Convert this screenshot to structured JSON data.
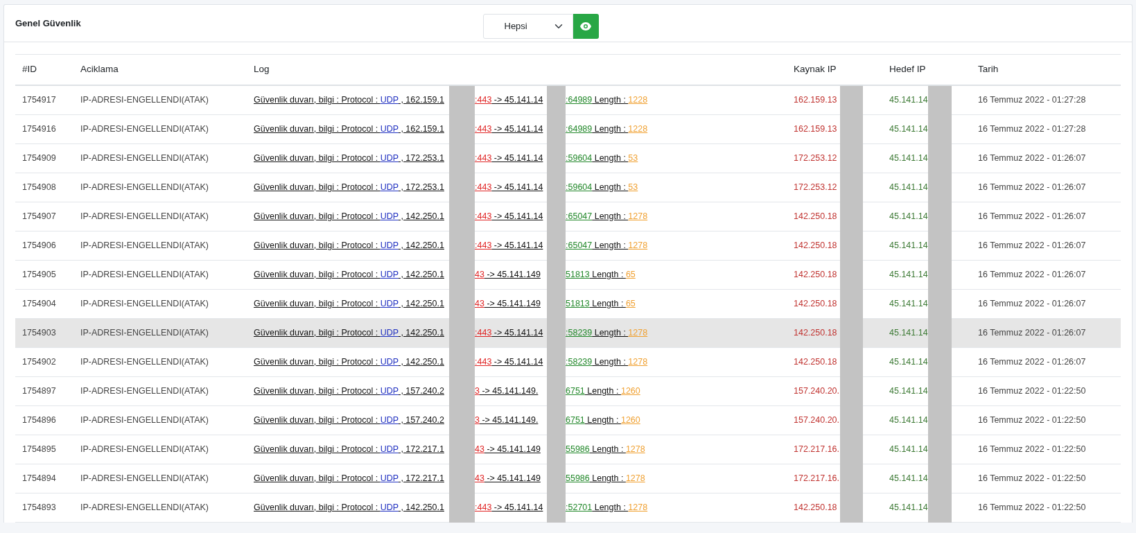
{
  "card": {
    "title": "Genel Güvenlik",
    "filter": {
      "value": "Hepsi"
    }
  },
  "table": {
    "columns": [
      "#ID",
      "Aciklama",
      "Log",
      "Kaynak IP",
      "Hedef IP",
      "Tarih"
    ],
    "rows": [
      {
        "id": "1754917",
        "description": "IP-ADRESI-ENGELLENDI(ATAK)",
        "log": {
          "label": "Güvenlik duvarı, bilgi : Protocol :",
          "protocol": "UDP",
          "source": ", 162.159.1",
          "source_port": ":443",
          "destination": "-> 45.141.14",
          "destination_port": ":64989",
          "length_label": "Length :",
          "length": "1228"
        },
        "source_ip": "162.159.13",
        "target_ip": "45.141.14",
        "date": "16 Temmuz 2022 - 01:27:28",
        "hovered": false
      },
      {
        "id": "1754916",
        "description": "IP-ADRESI-ENGELLENDI(ATAK)",
        "log": {
          "label": "Güvenlik duvarı, bilgi : Protocol :",
          "protocol": "UDP",
          "source": ", 162.159.1",
          "source_port": ":443",
          "destination": "-> 45.141.14",
          "destination_port": ":64989",
          "length_label": "Length :",
          "length": "1228"
        },
        "source_ip": "162.159.13",
        "target_ip": "45.141.14",
        "date": "16 Temmuz 2022 - 01:27:28",
        "hovered": false
      },
      {
        "id": "1754909",
        "description": "IP-ADRESI-ENGELLENDI(ATAK)",
        "log": {
          "label": "Güvenlik duvarı, bilgi : Protocol :",
          "protocol": "UDP",
          "source": ", 172.253.1",
          "source_port": ":443",
          "destination": "-> 45.141.14",
          "destination_port": ":59604",
          "length_label": "Length :",
          "length": "53"
        },
        "source_ip": "172.253.12",
        "target_ip": "45.141.14",
        "date": "16 Temmuz 2022 - 01:26:07",
        "hovered": false
      },
      {
        "id": "1754908",
        "description": "IP-ADRESI-ENGELLENDI(ATAK)",
        "log": {
          "label": "Güvenlik duvarı, bilgi : Protocol :",
          "protocol": "UDP",
          "source": ", 172.253.1",
          "source_port": ":443",
          "destination": "-> 45.141.14",
          "destination_port": ":59604",
          "length_label": "Length :",
          "length": "53"
        },
        "source_ip": "172.253.12",
        "target_ip": "45.141.14",
        "date": "16 Temmuz 2022 - 01:26:07",
        "hovered": false
      },
      {
        "id": "1754907",
        "description": "IP-ADRESI-ENGELLENDI(ATAK)",
        "log": {
          "label": "Güvenlik duvarı, bilgi : Protocol :",
          "protocol": "UDP",
          "source": ", 142.250.1",
          "source_port": ":443",
          "destination": "-> 45.141.14",
          "destination_port": ":65047",
          "length_label": "Length :",
          "length": "1278"
        },
        "source_ip": "142.250.18",
        "target_ip": "45.141.14",
        "date": "16 Temmuz 2022 - 01:26:07",
        "hovered": false
      },
      {
        "id": "1754906",
        "description": "IP-ADRESI-ENGELLENDI(ATAK)",
        "log": {
          "label": "Güvenlik duvarı, bilgi : Protocol :",
          "protocol": "UDP",
          "source": ", 142.250.1",
          "source_port": ":443",
          "destination": "-> 45.141.14",
          "destination_port": ":65047",
          "length_label": "Length :",
          "length": "1278"
        },
        "source_ip": "142.250.18",
        "target_ip": "45.141.14",
        "date": "16 Temmuz 2022 - 01:26:07",
        "hovered": false
      },
      {
        "id": "1754905",
        "description": "IP-ADRESI-ENGELLENDI(ATAK)",
        "log": {
          "label": "Güvenlik duvarı, bilgi : Protocol :",
          "protocol": "UDP",
          "source": ", 142.250.1",
          "source_port": "43",
          "destination": "-> 45.141.149",
          "destination_port": "51813",
          "length_label": "Length :",
          "length": "65"
        },
        "source_ip": "142.250.18",
        "target_ip": "45.141.14",
        "date": "16 Temmuz 2022 - 01:26:07",
        "hovered": false
      },
      {
        "id": "1754904",
        "description": "IP-ADRESI-ENGELLENDI(ATAK)",
        "log": {
          "label": "Güvenlik duvarı, bilgi : Protocol :",
          "protocol": "UDP",
          "source": ", 142.250.1",
          "source_port": "43",
          "destination": "-> 45.141.149",
          "destination_port": "51813",
          "length_label": "Length :",
          "length": "65"
        },
        "source_ip": "142.250.18",
        "target_ip": "45.141.14",
        "date": "16 Temmuz 2022 - 01:26:07",
        "hovered": false
      },
      {
        "id": "1754903",
        "description": "IP-ADRESI-ENGELLENDI(ATAK)",
        "log": {
          "label": "Güvenlik duvarı, bilgi : Protocol :",
          "protocol": "UDP",
          "source": ", 142.250.1",
          "source_port": ":443",
          "destination": "-> 45.141.14",
          "destination_port": ":58239",
          "length_label": "Length :",
          "length": "1278"
        },
        "source_ip": "142.250.18",
        "target_ip": "45.141.14",
        "date": "16 Temmuz 2022 - 01:26:07",
        "hovered": true
      },
      {
        "id": "1754902",
        "description": "IP-ADRESI-ENGELLENDI(ATAK)",
        "log": {
          "label": "Güvenlik duvarı, bilgi : Protocol :",
          "protocol": "UDP",
          "source": ", 142.250.1",
          "source_port": ":443",
          "destination": "-> 45.141.14",
          "destination_port": ":58239",
          "length_label": "Length :",
          "length": "1278"
        },
        "source_ip": "142.250.18",
        "target_ip": "45.141.14",
        "date": "16 Temmuz 2022 - 01:26:07",
        "hovered": false
      },
      {
        "id": "1754897",
        "description": "IP-ADRESI-ENGELLENDI(ATAK)",
        "log": {
          "label": "Güvenlik duvarı, bilgi : Protocol :",
          "protocol": "UDP",
          "source": ", 157.240.2",
          "source_port": "3",
          "destination": "-> 45.141.149.",
          "destination_port": "6751",
          "length_label": "Length :",
          "length": "1260"
        },
        "source_ip": "157.240.20.",
        "target_ip": "45.141.14",
        "date": "16 Temmuz 2022 - 01:22:50",
        "hovered": false
      },
      {
        "id": "1754896",
        "description": "IP-ADRESI-ENGELLENDI(ATAK)",
        "log": {
          "label": "Güvenlik duvarı, bilgi : Protocol :",
          "protocol": "UDP",
          "source": ", 157.240.2",
          "source_port": "3",
          "destination": "-> 45.141.149.",
          "destination_port": "6751",
          "length_label": "Length :",
          "length": "1260"
        },
        "source_ip": "157.240.20.",
        "target_ip": "45.141.14",
        "date": "16 Temmuz 2022 - 01:22:50",
        "hovered": false
      },
      {
        "id": "1754895",
        "description": "IP-ADRESI-ENGELLENDI(ATAK)",
        "log": {
          "label": "Güvenlik duvarı, bilgi : Protocol :",
          "protocol": "UDP",
          "source": ", 172.217.1",
          "source_port": "43",
          "destination": "-> 45.141.149",
          "destination_port": "55986",
          "length_label": "Length :",
          "length": "1278"
        },
        "source_ip": "172.217.16.",
        "target_ip": "45.141.14",
        "date": "16 Temmuz 2022 - 01:22:50",
        "hovered": false
      },
      {
        "id": "1754894",
        "description": "IP-ADRESI-ENGELLENDI(ATAK)",
        "log": {
          "label": "Güvenlik duvarı, bilgi : Protocol :",
          "protocol": "UDP",
          "source": ", 172.217.1",
          "source_port": "43",
          "destination": "-> 45.141.149",
          "destination_port": "55986",
          "length_label": "Length :",
          "length": "1278"
        },
        "source_ip": "172.217.16.",
        "target_ip": "45.141.14",
        "date": "16 Temmuz 2022 - 01:22:50",
        "hovered": false
      },
      {
        "id": "1754893",
        "description": "IP-ADRESI-ENGELLENDI(ATAK)",
        "log": {
          "label": "Güvenlik duvarı, bilgi : Protocol :",
          "protocol": "UDP",
          "source": ", 142.250.1",
          "source_port": ":443",
          "destination": "-> 45.141.14",
          "destination_port": ":52701",
          "length_label": "Length :",
          "length": "1278"
        },
        "source_ip": "142.250.18",
        "target_ip": "45.141.14",
        "date": "16 Temmuz 2022 - 01:22:50",
        "hovered": false
      }
    ]
  }
}
